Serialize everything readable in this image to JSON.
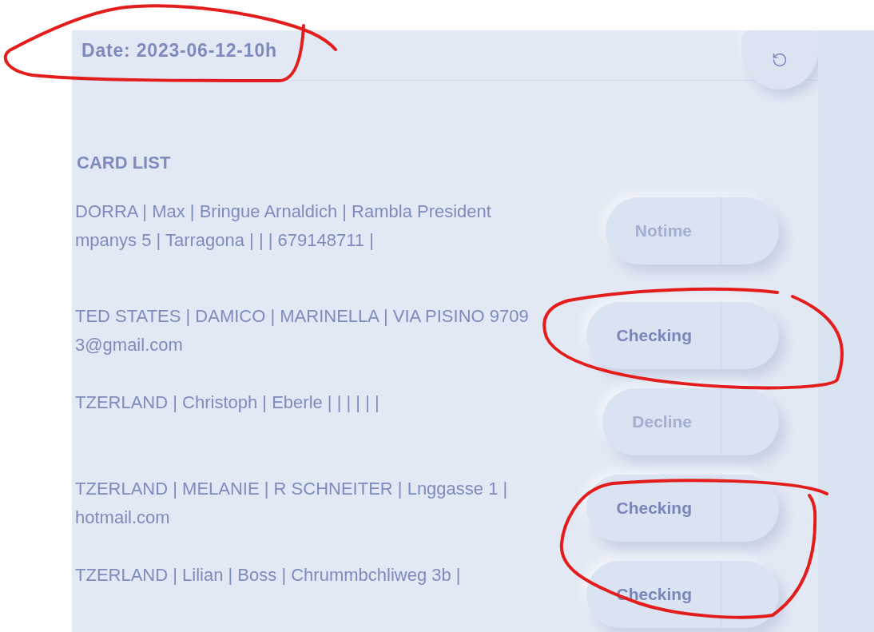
{
  "header": {
    "date": "Date: 2023-06-12-10h"
  },
  "section_title": "CARD LIST",
  "cards": [
    {
      "lines": [
        "DORRA | Max | Bringue Arnaldich | Rambla President",
        "mpanys 5 | Tarragona | | | 679148711 |"
      ],
      "status": {
        "label": "Notime",
        "disabled": true
      }
    },
    {
      "lines": [
        "TED STATES | DAMICO | MARINELLA | VIA PISINO 9709",
        "3@gmail.com"
      ],
      "status": {
        "label": "Checking",
        "disabled": false
      }
    },
    {
      "lines": [
        "TZERLAND | Christoph | Eberle | | | | | |"
      ],
      "status": {
        "label": "Decline",
        "disabled": true
      }
    },
    {
      "lines": [
        "TZERLAND | MELANIE | R SCHNEITER | Lnggasse 1 |",
        "hotmail.com"
      ],
      "status": {
        "label": "Checking",
        "disabled": false
      }
    },
    {
      "lines": [
        "TZERLAND | Lilian | Boss | Chrummbchliweg 3b |"
      ],
      "status": {
        "label": "Checking",
        "disabled": false
      }
    }
  ]
}
